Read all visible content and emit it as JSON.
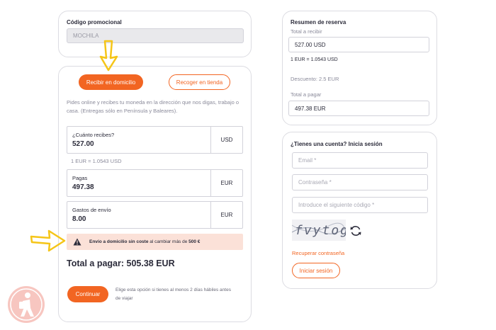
{
  "promo": {
    "label": "Código promocional",
    "value": "MOCHILA"
  },
  "delivery": {
    "tab_home": "Recibir en domicilio",
    "tab_store": "Recoger en tienda",
    "description": "Pides online y recibes tu moneda en la dirección que nos digas, trabajo o casa. (Entregas sólo en Península y Baleares).",
    "receive": {
      "label": "¿Cuánto recibes?",
      "value": "527.00",
      "currency": "USD"
    },
    "rate": "1 EUR = 1.0543 USD",
    "pay": {
      "label": "Pagas",
      "value": "497.38",
      "currency": "EUR"
    },
    "shipping": {
      "label": "Gastos de envío",
      "value": "8.00",
      "currency": "EUR"
    },
    "notice": {
      "bold_part": "Envío a domicilio sin coste",
      "middle_part": " al cambiar más de ",
      "amount": "500 €"
    },
    "total": "Total a pagar: 505.38 EUR",
    "continue_label": "Continuar",
    "continue_note": "Elige esta opción si tienes al menos 2 días hábiles antes de viajar"
  },
  "summary": {
    "title": "Resumen de reserva",
    "receive_label": "Total a recibir",
    "receive_value": "527.00 USD",
    "rate": "1 EUR = 1.0543 USD",
    "discount": "Descuento: 2.5 EUR",
    "pay_label": "Total a pagar",
    "pay_value": "497.38 EUR"
  },
  "login": {
    "title": "¿Tienes una cuenta? Inicia sesión",
    "email_placeholder": "Email *",
    "password_placeholder": "Contraseña *",
    "code_placeholder": "Introduce el siguiente código *",
    "captcha_text": "fvytog",
    "recover_link": "Recuperar contraseña",
    "login_button": "Iniciar sesión"
  },
  "colors": {
    "accent": "#f26522",
    "notice_bg": "#fbe1d8",
    "arrow": "#f5c518"
  }
}
